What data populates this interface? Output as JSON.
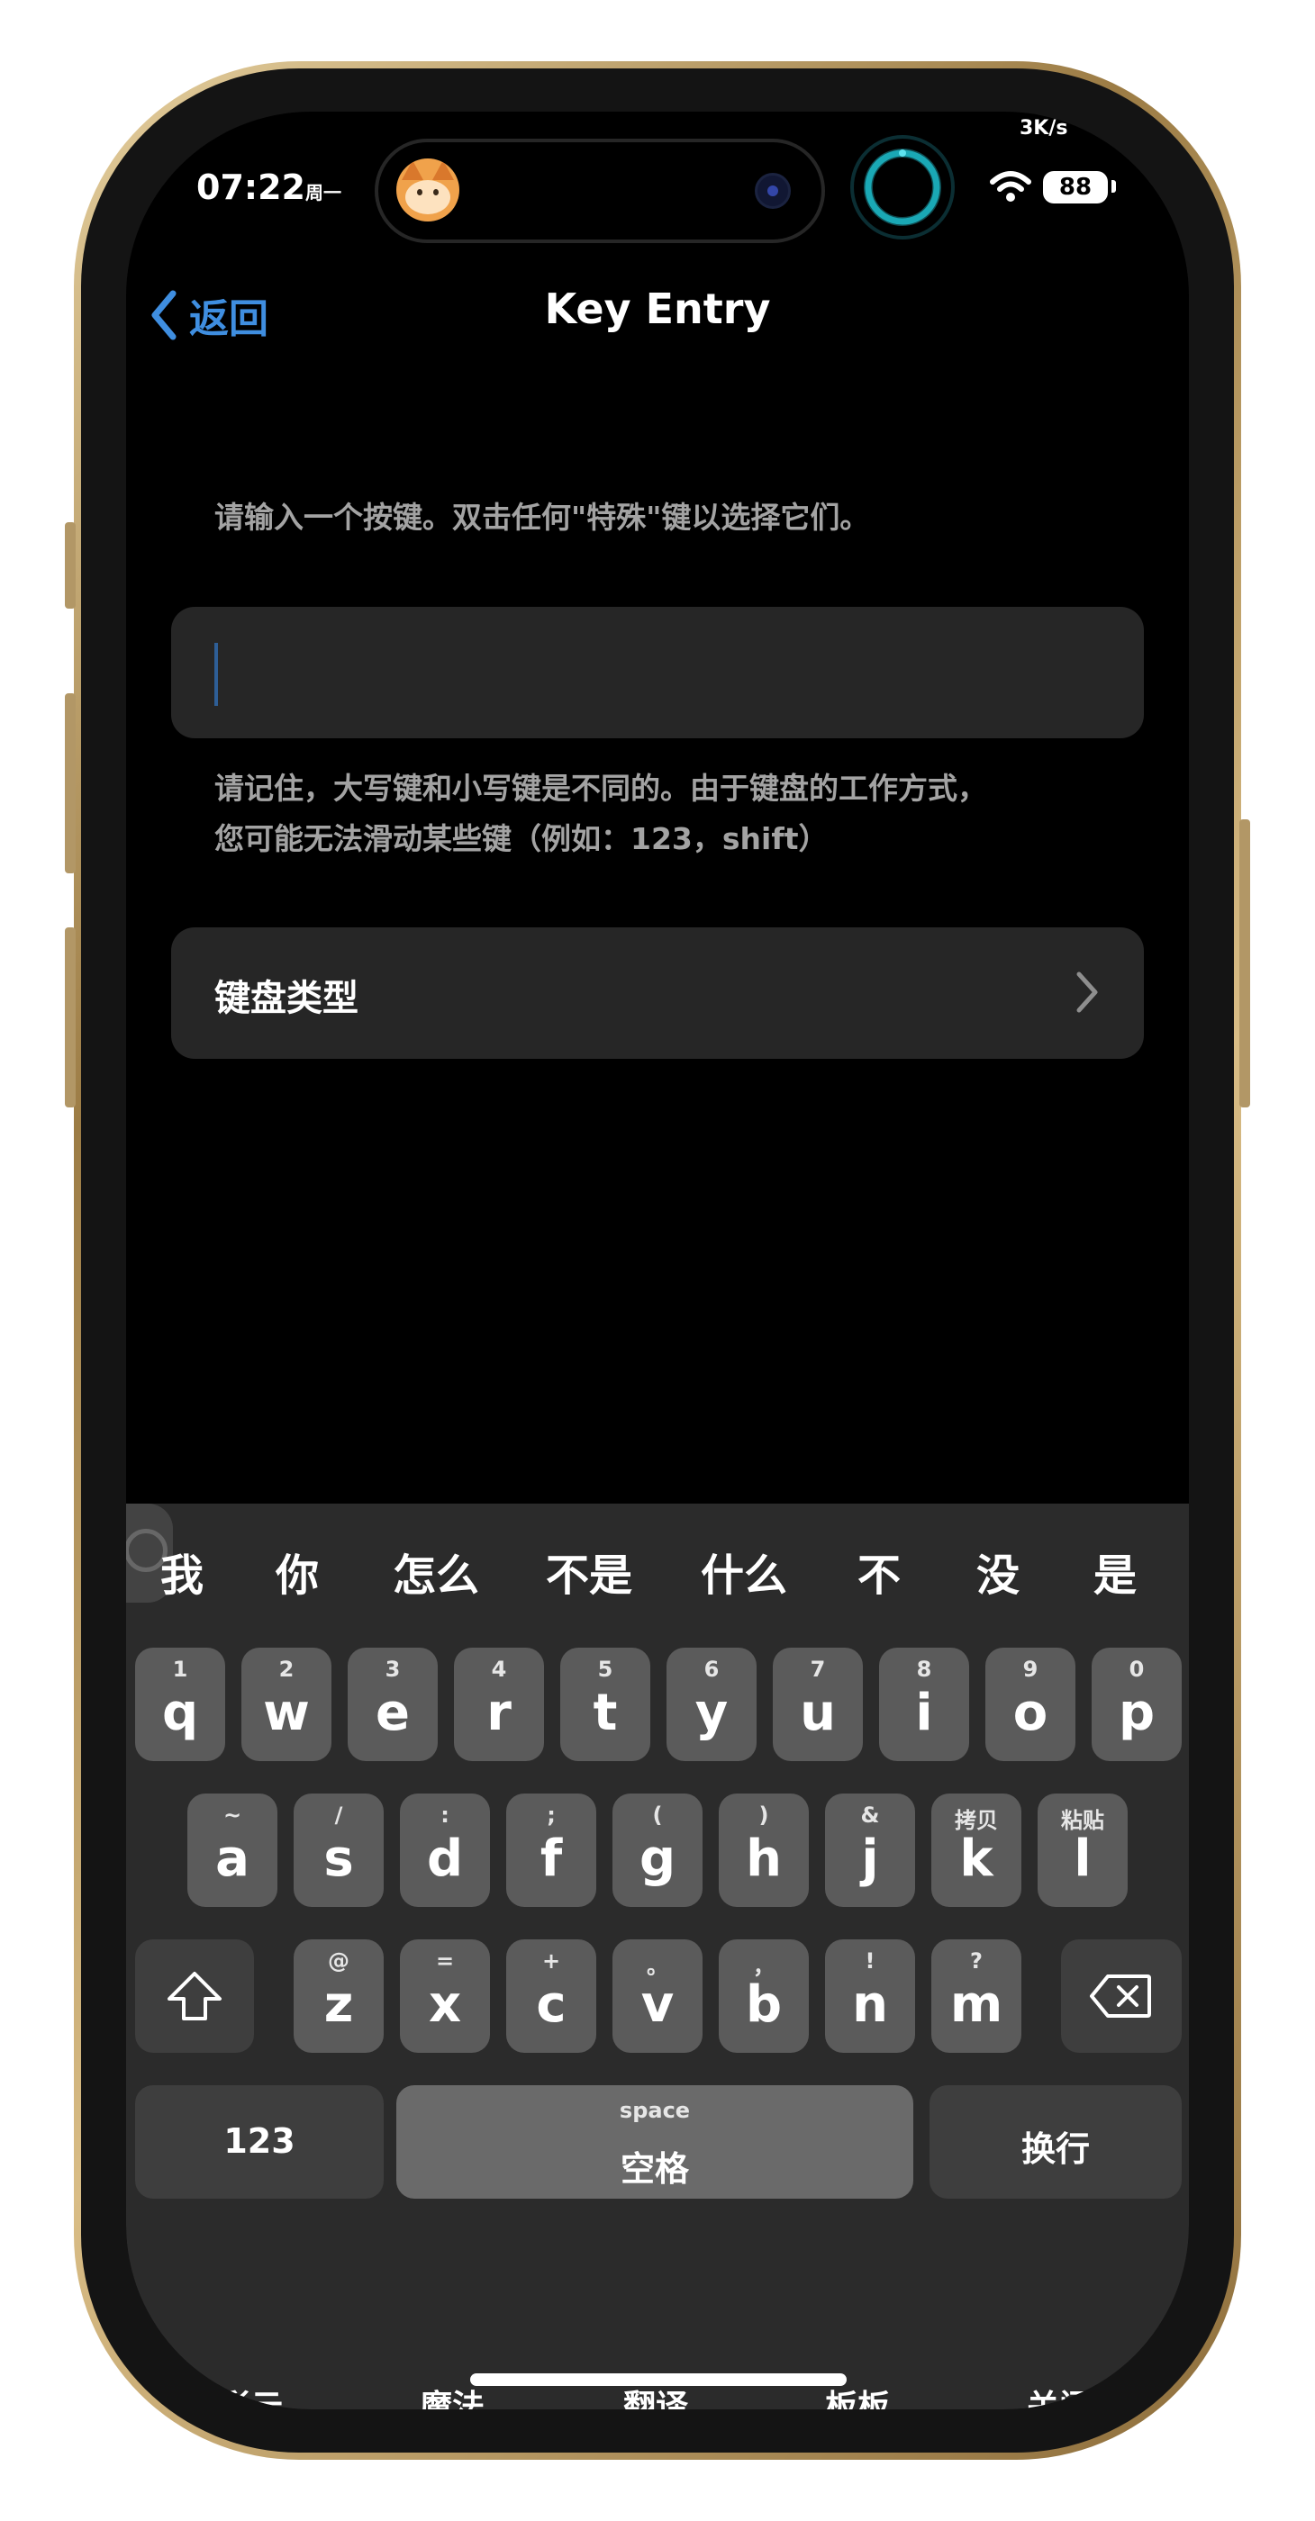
{
  "status": {
    "time": "07:22",
    "weekday": "周一",
    "net_speed": "3K/s",
    "battery": "88"
  },
  "nav": {
    "back_label": "返回",
    "title": "Key Entry"
  },
  "content": {
    "instruction": "请输入一个按键。双击任何\"特殊\"键以选择它们。",
    "input_value": "",
    "note_line1": "请记住，大写键和小写键是不同的。由于键盘的工作方式，",
    "note_line2": "您可能无法滑动某些键（例如：123，shift）",
    "keyboard_type_label": "键盘类型"
  },
  "keyboard": {
    "candidates": [
      "我",
      "你",
      "怎么",
      "不是",
      "什么",
      "不",
      "没",
      "是"
    ],
    "row1": [
      {
        "sup": "1",
        "key": "q"
      },
      {
        "sup": "2",
        "key": "w"
      },
      {
        "sup": "3",
        "key": "e"
      },
      {
        "sup": "4",
        "key": "r"
      },
      {
        "sup": "5",
        "key": "t"
      },
      {
        "sup": "6",
        "key": "y"
      },
      {
        "sup": "7",
        "key": "u"
      },
      {
        "sup": "8",
        "key": "i"
      },
      {
        "sup": "9",
        "key": "o"
      },
      {
        "sup": "0",
        "key": "p"
      }
    ],
    "row2": [
      {
        "sup": "~",
        "key": "a"
      },
      {
        "sup": "/",
        "key": "s"
      },
      {
        "sup": ":",
        "key": "d"
      },
      {
        "sup": ";",
        "key": "f"
      },
      {
        "sup": "(",
        "key": "g"
      },
      {
        "sup": ")",
        "key": "h"
      },
      {
        "sup": "&",
        "key": "j"
      },
      {
        "sup": "拷贝",
        "key": "k"
      },
      {
        "sup": "粘贴",
        "key": "l"
      }
    ],
    "row3": [
      {
        "sup": "@",
        "key": "z"
      },
      {
        "sup": "=",
        "key": "x"
      },
      {
        "sup": "+",
        "key": "c"
      },
      {
        "sup": "。",
        "key": "v"
      },
      {
        "sup": "，",
        "key": "b"
      },
      {
        "sup": "!",
        "key": "n"
      },
      {
        "sup": "?",
        "key": "m"
      }
    ],
    "num_key": "123",
    "space_sup": "space",
    "space_label": "空格",
    "return_label": "换行",
    "toolbar": [
      "彩云",
      "魔法",
      "翻译",
      "板板",
      "关闭"
    ]
  },
  "colors": {
    "accent": "#3f8ee0",
    "background": "#000000",
    "cell": "#262626",
    "key": "#5b5b5b",
    "key_dark": "#3e3e3e",
    "keyboard_bg": "#2b2b2b"
  }
}
